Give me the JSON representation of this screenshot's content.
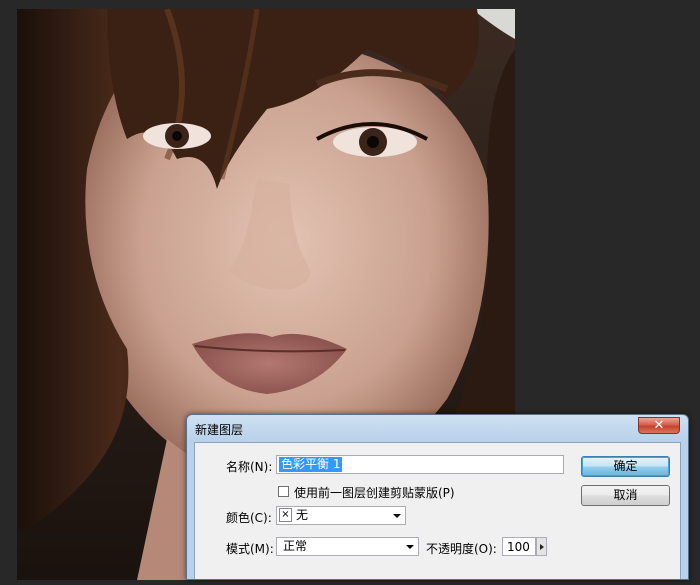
{
  "dialog": {
    "title": "新建图层",
    "close_glyph": "✕",
    "name_label": "名称(N):",
    "name_value": "色彩平衡 1",
    "clip_checkbox_label": "使用前一图层创建剪贴蒙版(P)",
    "clip_checked": false,
    "color_label": "颜色(C):",
    "color_value": "无",
    "color_swatch_glyph": "×",
    "mode_label": "模式(M):",
    "mode_value": "正常",
    "opacity_label": "不透明度(O):",
    "opacity_value": "100",
    "ok_label": "确定",
    "cancel_label": "取消"
  },
  "canvas": {
    "content": "portrait photo",
    "icons": [
      "photo-portrait"
    ]
  },
  "colors": {
    "workspace": "#282828",
    "title_gradient_top": "#cfe0f3",
    "selection": "#3399ff",
    "close_button": "#c6432c"
  }
}
